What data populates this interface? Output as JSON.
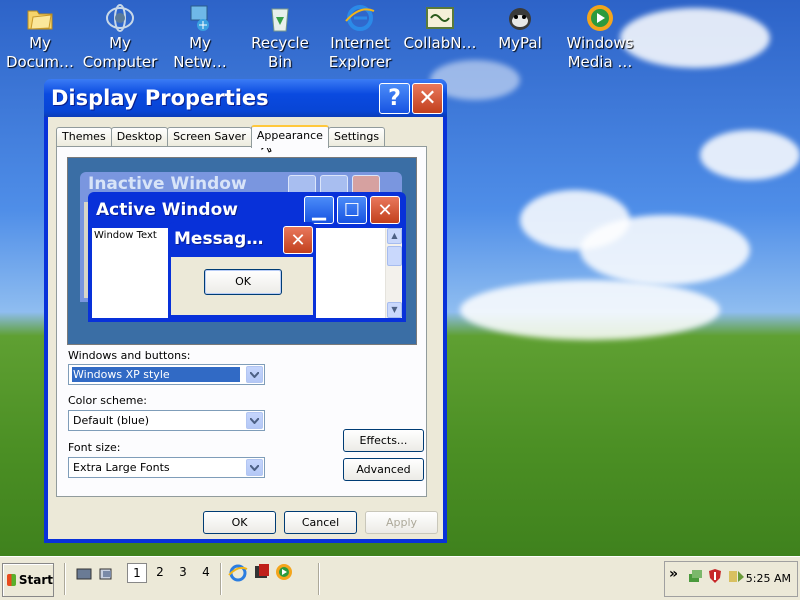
{
  "desktop": {
    "icons": [
      {
        "label": "My Docum…",
        "label1": "My",
        "label2": "Docum…",
        "icon": "my-documents-icon"
      },
      {
        "label1": "My",
        "label2": "Computer",
        "icon": "my-computer-icon"
      },
      {
        "label1": "My",
        "label2": "Netw…",
        "icon": "my-network-icon"
      },
      {
        "label1": "Recycle",
        "label2": "Bin",
        "icon": "recycle-bin-icon"
      },
      {
        "label1": "Internet",
        "label2": "Explorer",
        "icon": "internet-explorer-icon"
      },
      {
        "label1": "CollabN…",
        "label2": "",
        "icon": "collabnet-icon"
      },
      {
        "label1": "MyPal",
        "label2": "",
        "icon": "mypal-icon"
      },
      {
        "label1": "Windows",
        "label2": "Media …",
        "icon": "windows-media-icon"
      }
    ]
  },
  "dialog": {
    "title": "Display Properties",
    "help_glyph": "?",
    "close_glyph": "✕",
    "tabs": [
      "Themes",
      "Desktop",
      "Screen Saver",
      "Appearance",
      "Settings"
    ],
    "active_tab": "Appearance",
    "preview": {
      "inactive_title": "Inactive Window",
      "active_title": "Active Window",
      "window_text": "Window Text",
      "message_title": "Messag…",
      "message_ok": "OK"
    },
    "windows_and_buttons_label": "Windows and buttons:",
    "windows_and_buttons_value": "Windows XP style",
    "color_scheme_label": "Color scheme:",
    "color_scheme_value": "Default (blue)",
    "font_size_label": "Font size:",
    "font_size_value": "Extra Large Fonts",
    "effects_label": "Effects...",
    "advanced_label": "Advanced",
    "ok_label": "OK",
    "cancel_label": "Cancel",
    "apply_label": "Apply"
  },
  "taskbar": {
    "start_label": "Start",
    "pages": [
      "1",
      "2",
      "3",
      "4"
    ],
    "active_page": "1",
    "expand_glyph": "»",
    "clock": "5:25 AM"
  },
  "colors": {
    "title_blue": "#0831d9",
    "face": "#ece9d8",
    "close_red": "#c2401d",
    "selection": "#316ac5"
  }
}
